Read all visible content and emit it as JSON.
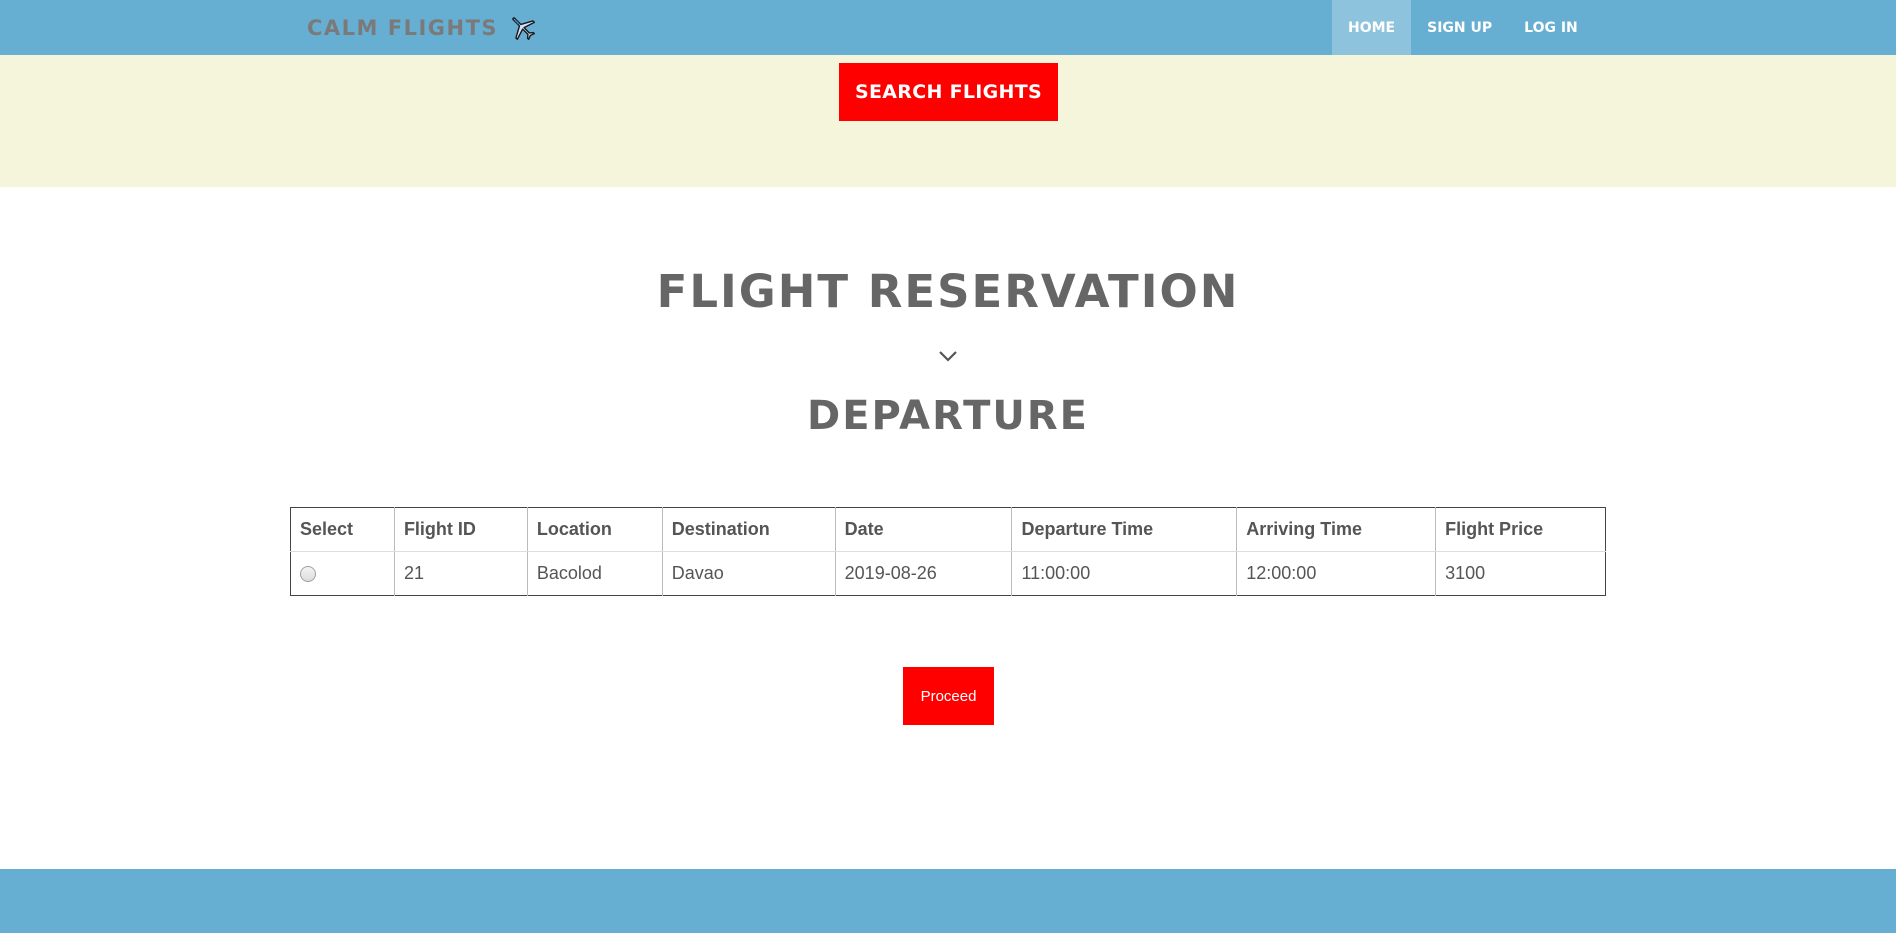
{
  "nav": {
    "brand": "CALM FLIGHTS",
    "brand_icon": "airplane-icon",
    "links": [
      {
        "label": "HOME",
        "active": true
      },
      {
        "label": "SIGN UP",
        "active": false
      },
      {
        "label": "LOG IN",
        "active": false
      }
    ]
  },
  "search": {
    "button_label": "SEARCH FLIGHTS"
  },
  "main": {
    "title": "FLIGHT RESERVATION",
    "divider_icon": "chevron-down-icon",
    "subtitle": "DEPARTURE"
  },
  "table": {
    "columns": [
      "Select",
      "Flight ID",
      "Location",
      "Destination",
      "Date",
      "Departure Time",
      "Arriving Time",
      "Flight Price"
    ],
    "rows": [
      {
        "selected": false,
        "flight_id": "21",
        "location": "Bacolod",
        "destination": "Davao",
        "date": "2019-08-26",
        "departure_time": "11:00:00",
        "arriving_time": "12:00:00",
        "flight_price": "3100"
      }
    ]
  },
  "actions": {
    "proceed_label": "Proceed"
  },
  "colors": {
    "navbar": "#67afd2",
    "nav_active": "#8ec3dd",
    "search_band": "#f5f5dc",
    "accent_red": "#ff0000",
    "heading_gray": "#666666"
  }
}
